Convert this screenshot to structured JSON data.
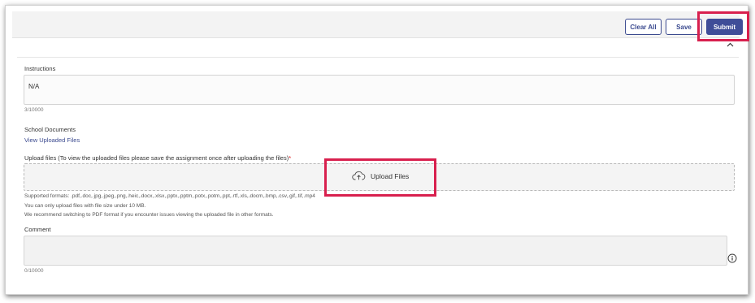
{
  "toolbar": {
    "clear_all_label": "Clear All",
    "save_label": "Save",
    "submit_label": "Submit"
  },
  "section": {
    "collapse_icon": "chevron-up-icon"
  },
  "instructions": {
    "label": "Instructions",
    "value": "N/A",
    "char_count": "3/10000"
  },
  "school_documents": {
    "label": "School Documents",
    "view_link": "View Uploaded Files"
  },
  "upload": {
    "label": "Upload files (To view the uploaded files please save the assignment once after uploading the files)",
    "required_mark": "*",
    "button_label": "Upload Files",
    "icon": "cloud-upload-icon",
    "supported_formats": "Supported formats: .pdf,.doc,.jpg,.jpeg,.png,.heic,.docx,.xlsx,.pptx,.pptm,.potx,.potm,.ppt,.rtf,.xls,.docm,.bmp,.csv,.gif,.tif,.mp4",
    "size_note": "You can only upload files with file size under 10 MB.",
    "pdf_note": "We recommend switching to PDF format if you encounter issues viewing the uploaded file in other formats."
  },
  "comment": {
    "label": "Comment",
    "value": "",
    "char_count": "0/10000",
    "info_icon": "info-icon"
  },
  "colors": {
    "primary": "#3f4d98",
    "highlight": "#d8204e"
  }
}
